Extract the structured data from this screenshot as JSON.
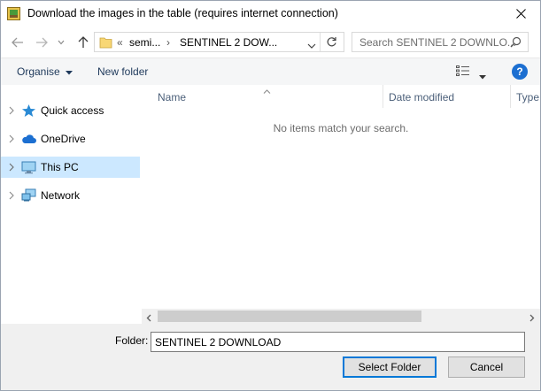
{
  "window": {
    "title": "Download the images in the table (requires internet connection)"
  },
  "address": {
    "prefix": "«",
    "crumb1": "semi...",
    "separator": "›",
    "crumb2": "SENTINEL 2 DOW..."
  },
  "search": {
    "placeholder": "Search SENTINEL 2 DOWNLO..."
  },
  "toolbar": {
    "organise": "Organise",
    "new_folder": "New folder"
  },
  "nav": {
    "items": [
      {
        "label": "Quick access",
        "icon": "star-icon"
      },
      {
        "label": "OneDrive",
        "icon": "cloud-icon"
      },
      {
        "label": "This PC",
        "icon": "computer-icon",
        "selected": true
      },
      {
        "label": "Network",
        "icon": "network-icon"
      }
    ]
  },
  "columns": {
    "name": "Name",
    "date_modified": "Date modified",
    "type": "Type"
  },
  "content": {
    "empty_message": "No items match your search."
  },
  "footer": {
    "folder_label": "Folder:",
    "folder_value": "SENTINEL 2 DOWNLOAD",
    "select_button": "Select Folder",
    "cancel_button": "Cancel"
  },
  "colors": {
    "accent": "#0078d7",
    "selected_bg": "#cce8ff",
    "toolbar_bg": "#f5f6f7",
    "footer_bg": "#f0f0f0",
    "help": "#1c6fd1"
  }
}
